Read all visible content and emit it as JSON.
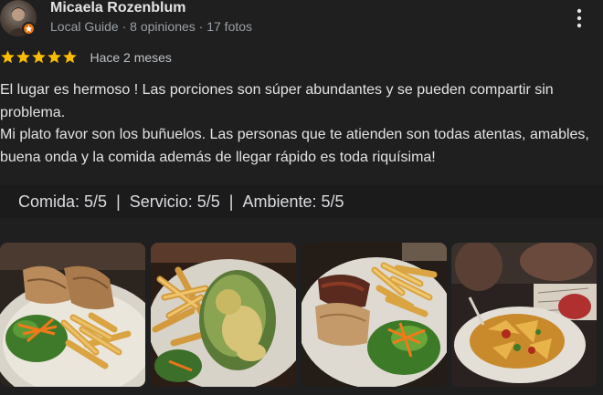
{
  "user": {
    "name": "Micaela Rozenblum",
    "meta": "Local Guide · 8 opiniones · 17 fotos",
    "avatar_icon": "user-avatar-photo",
    "badge_icon": "local-guide-badge-icon"
  },
  "menu_icon": "more-vert-icon",
  "rating": {
    "stars": 5,
    "max_stars": 5,
    "star_color": "#fbbc04",
    "time_ago": "Hace 2 meses"
  },
  "review": {
    "paragraph_1": "El lugar es hermoso ! Las porciones son súper abundantes y se pueden compartir sin problema.",
    "paragraph_2": "Mi plato favor son los buñuelos. Las personas que te atienden son todas atentas, amables, buena onda y la comida además de llegar rápido es toda riquísima!"
  },
  "sub_ratings": [
    {
      "text": "Comida: 5/5"
    },
    {
      "text": "Servicio: 5/5"
    },
    {
      "text": "Ambiente: 5/5"
    }
  ],
  "separator": "|",
  "photos": [
    {
      "name": "photo-wraps-fries-salad"
    },
    {
      "name": "photo-spinach-bunuelos-fries"
    },
    {
      "name": "photo-wrap-fries-salad-plate"
    },
    {
      "name": "photo-nachos-plate"
    }
  ],
  "colors": {
    "background": "#1f1f1f",
    "text_primary": "#e3e3e3",
    "text_secondary": "#9aa0a6",
    "star": "#fbbc04",
    "guide_badge": "#e8710a"
  }
}
